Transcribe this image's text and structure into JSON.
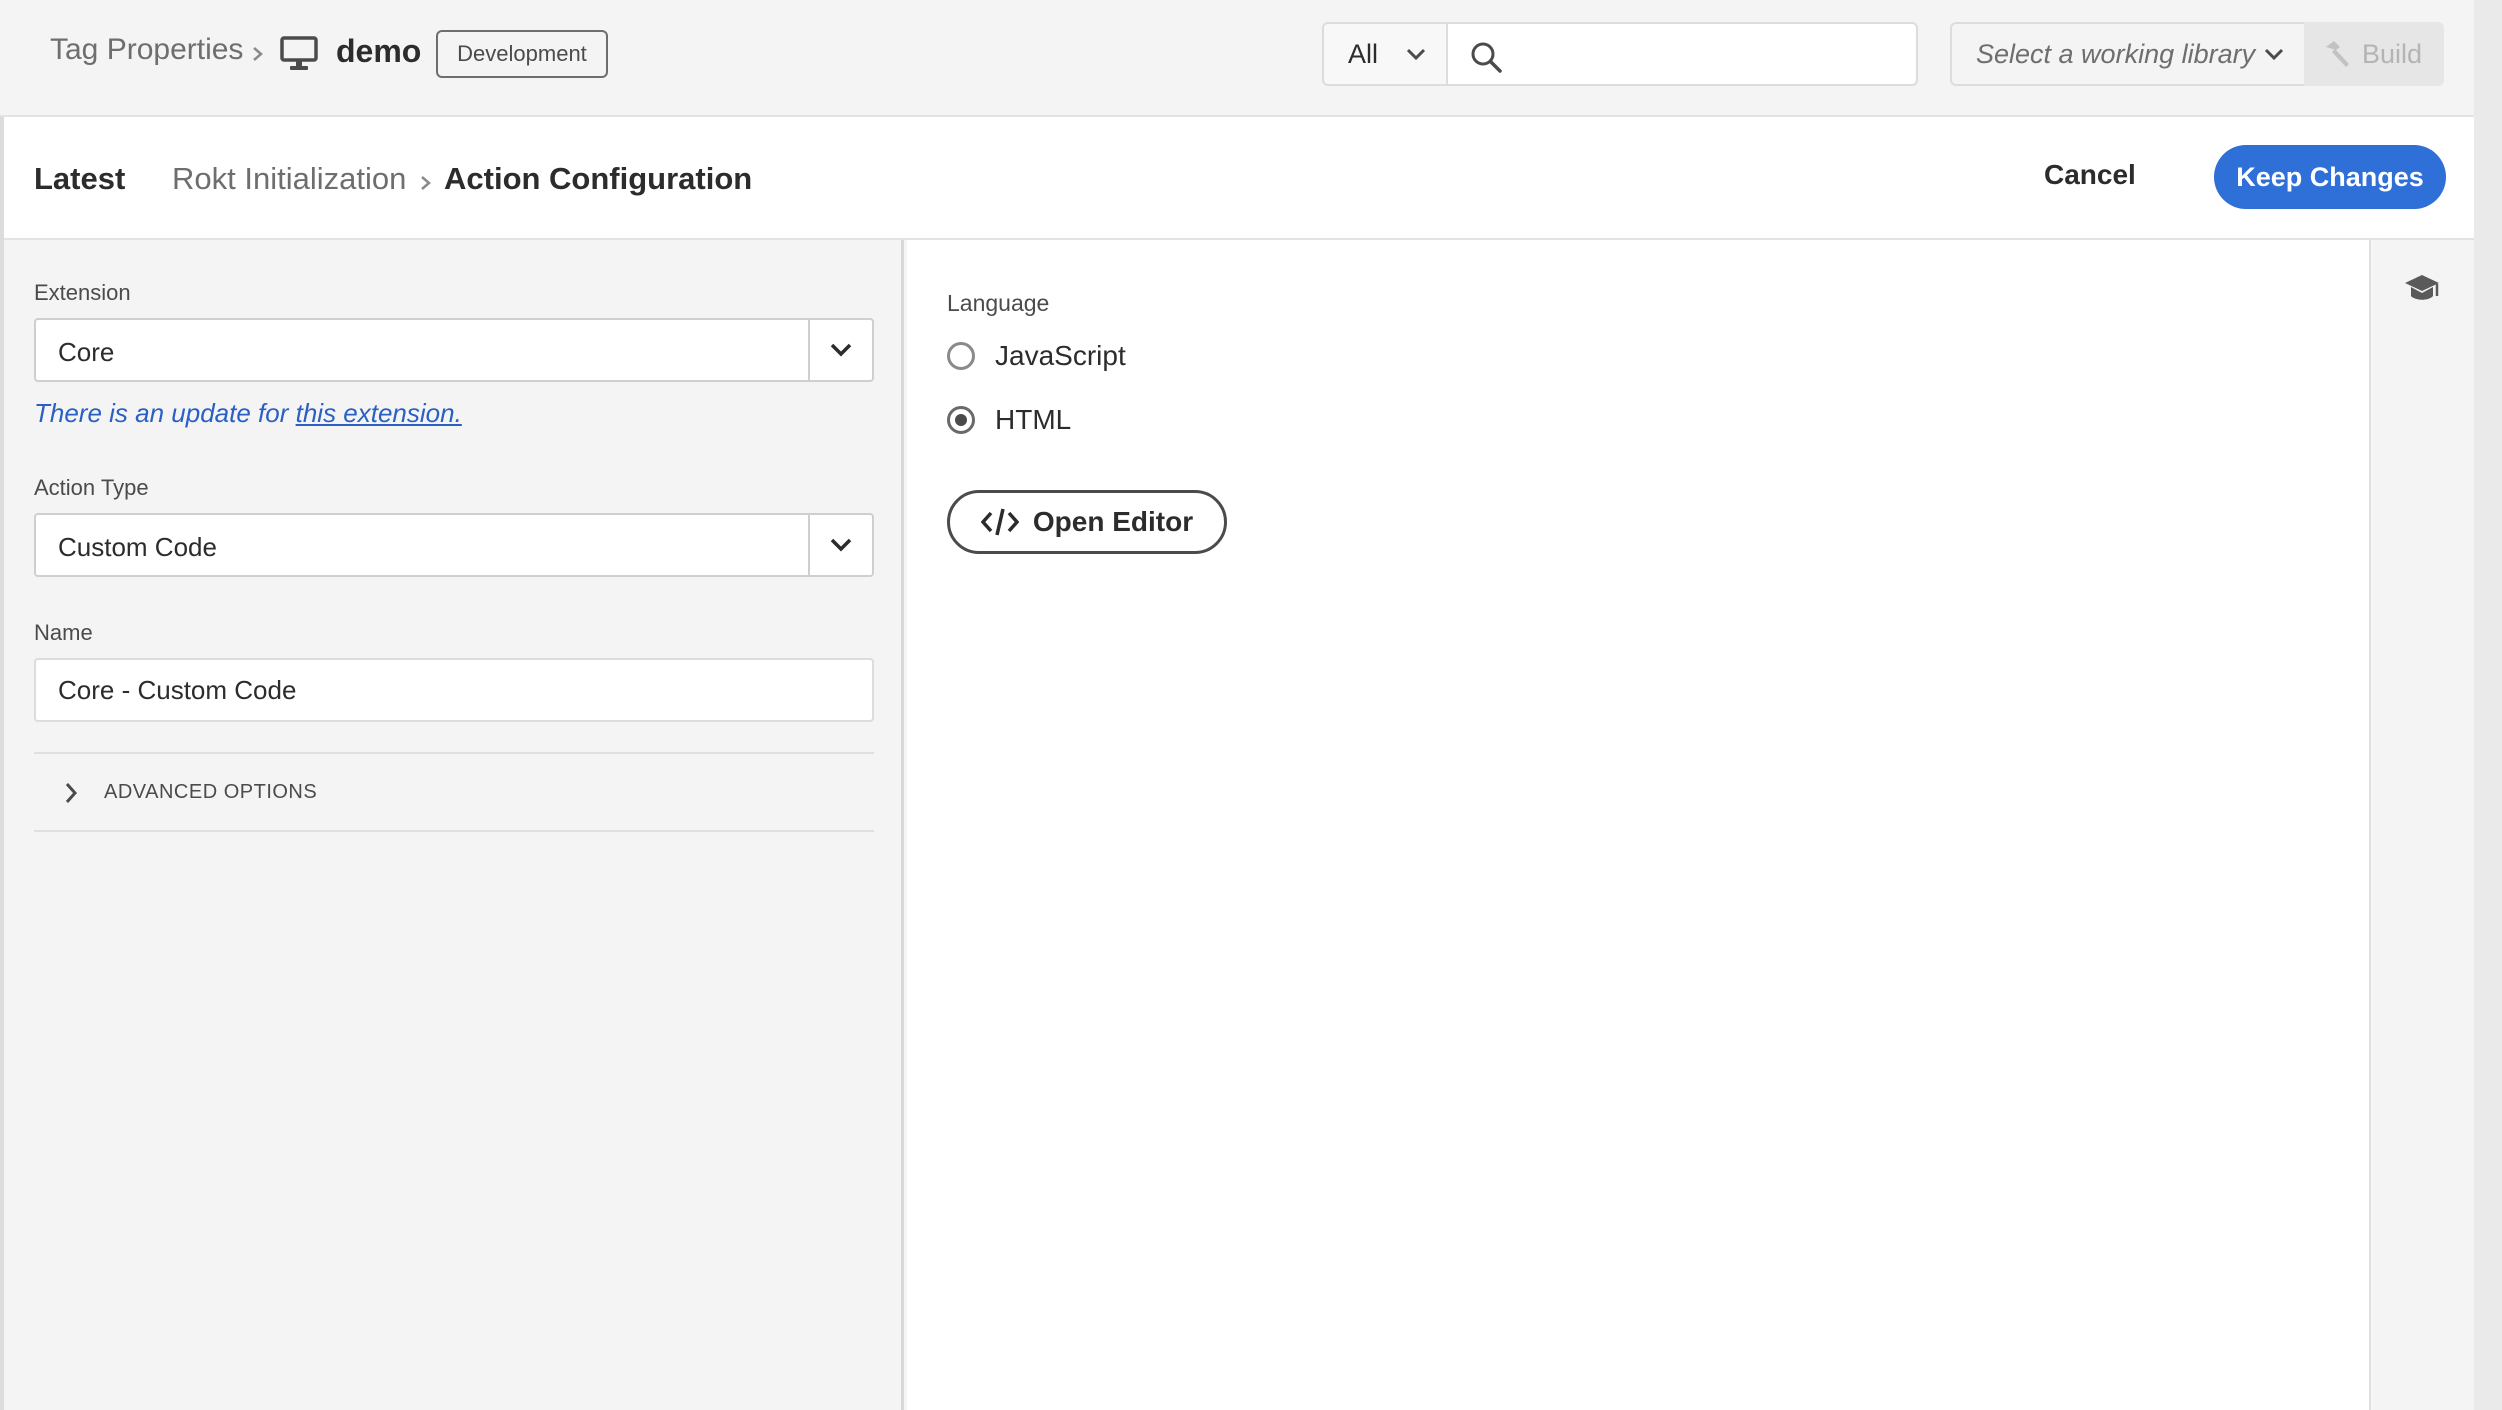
{
  "header": {
    "breadcrumb_root": "Tag Properties",
    "property_name": "demo",
    "environment_badge": "Development",
    "search_scope": "All",
    "search_placeholder": "",
    "library_placeholder": "Select a working library",
    "build_label": "Build"
  },
  "subheader": {
    "latest_label": "Latest",
    "rule_name": "Rokt Initialization",
    "current_page": "Action Configuration",
    "cancel_label": "Cancel",
    "keep_label": "Keep Changes"
  },
  "form": {
    "extension_label": "Extension",
    "extension_value": "Core",
    "update_note_prefix": "There is an update for ",
    "update_note_link": "this extension.",
    "action_type_label": "Action Type",
    "action_type_value": "Custom Code",
    "name_label": "Name",
    "name_value": "Core - Custom Code",
    "advanced_options_label": "ADVANCED OPTIONS"
  },
  "editor": {
    "language_label": "Language",
    "languages": [
      {
        "label": "JavaScript",
        "selected": false
      },
      {
        "label": "HTML",
        "selected": true
      }
    ],
    "open_editor_label": "Open Editor"
  },
  "colors": {
    "primary": "#2f6fd8",
    "link": "#2a5fc4"
  },
  "icons": [
    "monitor-icon",
    "chevron-right-icon",
    "chevron-down-icon",
    "search-icon",
    "hammer-icon",
    "code-icon",
    "graduation-cap-icon"
  ]
}
